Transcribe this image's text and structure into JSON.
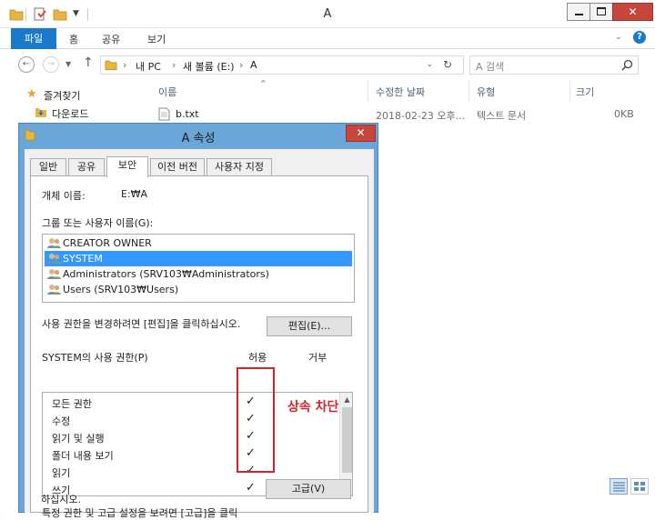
{
  "explorer": {
    "title": "A",
    "ribbon_tabs": [
      "파일",
      "홈",
      "공유",
      "보기"
    ],
    "address": {
      "segments": [
        "내 PC",
        "새 볼륨 (E:)",
        "A"
      ]
    },
    "search_placeholder": "A 검색",
    "columns": [
      "이름",
      "수정한 날짜",
      "유형",
      "크기"
    ],
    "nav": [
      {
        "label": "즐겨찾기"
      },
      {
        "label": "다운로드"
      }
    ],
    "files": [
      {
        "name": "b.txt",
        "modified": "2018-02-23 오후...",
        "type": "텍스트 문서",
        "size": "0KB"
      }
    ]
  },
  "dialog": {
    "title": "A 속성",
    "tabs": [
      "일반",
      "공유",
      "보안",
      "이전 버전",
      "사용자 지정"
    ],
    "active_tab": "보안",
    "object_label": "개체 이름:",
    "object_value": "E:₩A",
    "group_label": "그룹 또는 사용자 이름(G):",
    "users": [
      {
        "name": "CREATOR OWNER",
        "selected": false
      },
      {
        "name": "SYSTEM",
        "selected": true
      },
      {
        "name": "Administrators (SRV103₩Administrators)",
        "selected": false
      },
      {
        "name": "Users (SRV103₩Users)",
        "selected": false
      }
    ],
    "edit_hint": "사용 권한을 변경하려면 [편집]을 클릭하십시오.",
    "edit_button": "편집(E)...",
    "perm_label": "SYSTEM의 사용 권한(P)",
    "allow_header": "허용",
    "deny_header": "거부",
    "permissions": [
      {
        "name": "모든 권한",
        "allow": "✓",
        "deny": ""
      },
      {
        "name": "수정",
        "allow": "✓",
        "deny": ""
      },
      {
        "name": "읽기 및 실행",
        "allow": "✓",
        "deny": ""
      },
      {
        "name": "폴더 내용 보기",
        "allow": "✓",
        "deny": ""
      },
      {
        "name": "읽기",
        "allow": "✓",
        "deny": ""
      },
      {
        "name": "쓰기",
        "allow": "✓",
        "deny": ""
      }
    ],
    "advanced_hint_line1": "특정 권한 및 고급 설정을 보려면 [고급]을 클릭",
    "advanced_hint_line2": "하십시오.",
    "advanced_button": "고급(V)"
  },
  "annotation": {
    "text": "상속 차단",
    "color": "#d2242c"
  },
  "colors": {
    "accent": "#1979ca",
    "selection": "#3399ff",
    "dialog_frame": "#6aa7d8",
    "close": "#c7463c"
  }
}
